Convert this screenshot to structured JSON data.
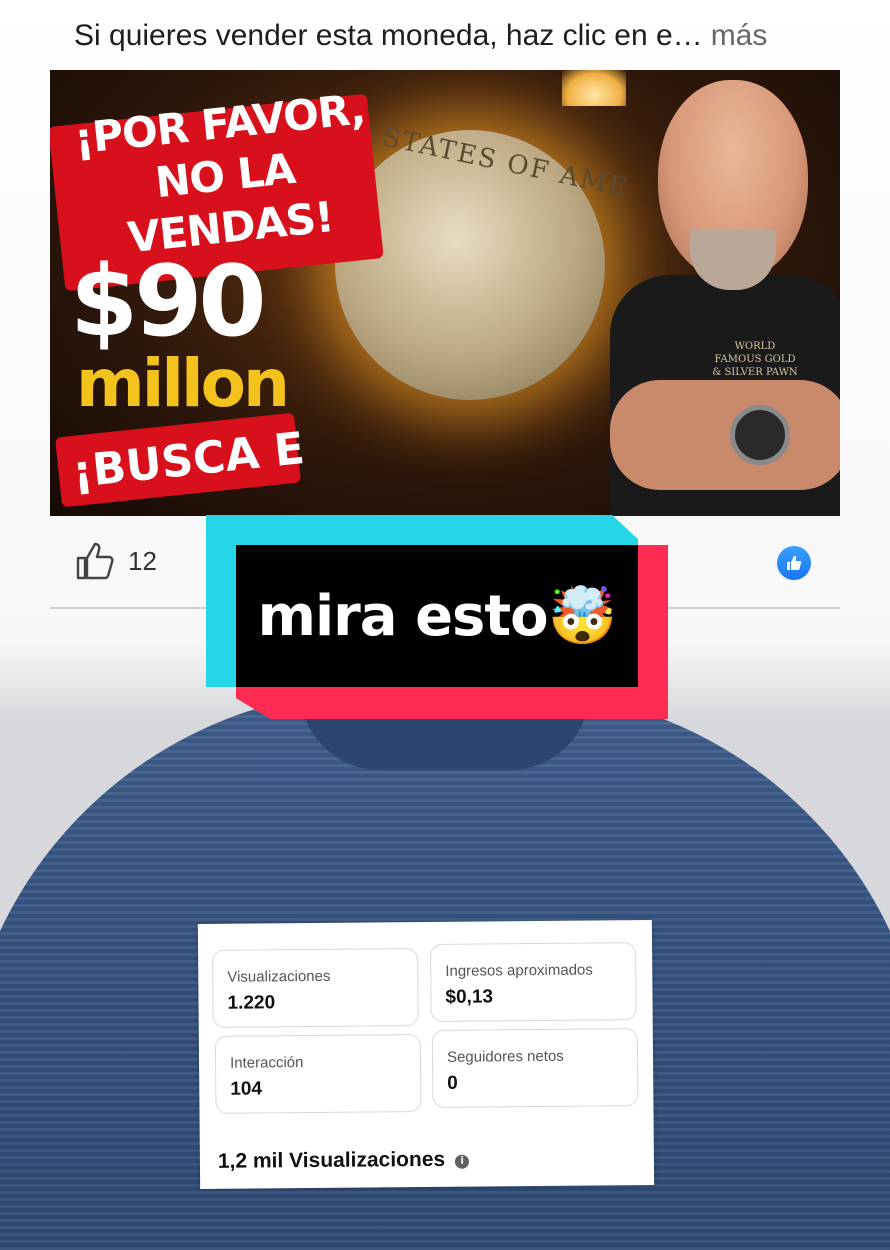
{
  "post": {
    "caption": "Si quieres vender esta moneda, haz clic en e…",
    "more_label": "más",
    "thumbnail": {
      "title_banner": "¡POR FAVOR, NO LA VENDAS!",
      "price": "$90",
      "unit": "millon",
      "search_banner": "¡BUSCA E",
      "coin_text": "STATES OF AME",
      "shirt_logo": "WORLD FAMOUS GOLD & SILVER PAWN SHOP"
    },
    "reactions": {
      "like_count": "12",
      "like_icon": "thumbs-up-icon",
      "reaction_badge": "facebook-like-badge-icon"
    }
  },
  "sticker": {
    "text": "mira esto🤯",
    "colors": {
      "cyan": "#25d6e8",
      "red": "#fe2c55",
      "black": "#000000"
    }
  },
  "stats": {
    "metrics": [
      {
        "label": "Visualizaciones",
        "value": "1.220"
      },
      {
        "label": "Ingresos aproximados",
        "value": "$0,13"
      },
      {
        "label": "Interacción",
        "value": "104"
      },
      {
        "label": "Seguidores netos",
        "value": "0"
      }
    ],
    "summary": "1,2 mil Visualizaciones",
    "summary_icon": "info-icon"
  }
}
